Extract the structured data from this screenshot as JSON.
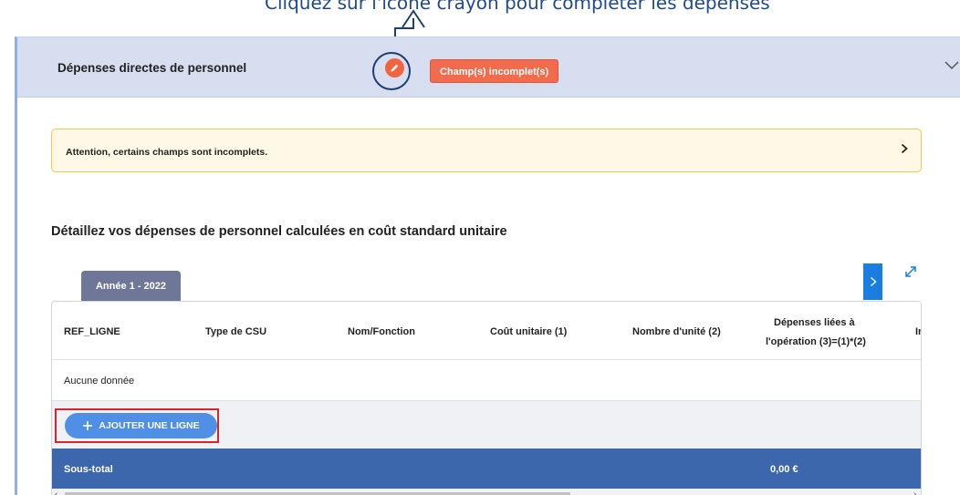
{
  "annotation": {
    "caption": "Cliquez sur l'icône crayon pour compléter les dépenses"
  },
  "panel": {
    "title": "Dépenses directes de personnel",
    "badge": "Champ(s) incomplet(s)",
    "edit_icon": "pencil-icon",
    "collapse_icon": "chevron-down-icon"
  },
  "warning": {
    "text": "Attention, certains champs sont incomplets.",
    "expand_icon": "chevron-right-icon"
  },
  "section": {
    "title": "Détaillez vos dépenses de personnel calculées en coût standard unitaire"
  },
  "tabs": [
    {
      "label": "Année 1 - 2022",
      "active": true
    }
  ],
  "table": {
    "columns": [
      "REF_LIGNE",
      "Type de CSU",
      "Nom/Fonction",
      "Coût unitaire (1)",
      "Nombre d'unité (2)",
      "Dépenses liées à l'opération (3)=(1)*(2)",
      "In"
    ],
    "columns_extra": {
      "dep_line1": "Dépenses liées à",
      "dep_line2": "l'opération (3)=(1)*(2)"
    },
    "empty_text": "Aucune donnée",
    "add_button": "AJOUTER UNE LIGNE",
    "subtotal_label": "Sous-total",
    "subtotal_value": "0,00 €"
  },
  "colors": {
    "header_bg": "#d6def0",
    "badge_bg": "#f26b4d",
    "accent_blue": "#1a7de0",
    "subtotal_bg": "#3c67ad",
    "warning_border": "#f2c94c"
  }
}
